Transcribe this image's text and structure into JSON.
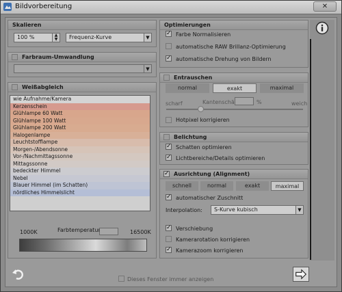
{
  "window": {
    "title": "Bildvorbereitung",
    "close_glyph": "✕"
  },
  "scaling": {
    "header": "Skalieren",
    "percent_value": "100 %",
    "method_value": "Frequenz-Kurve"
  },
  "colorspace": {
    "header": "Farbraum-Umwandlung",
    "checked": false
  },
  "whitebalance": {
    "header": "Weißabgleich",
    "checked": false,
    "items": [
      {
        "label": "wie Aufnahme/Kamera",
        "color": "#d4d4d4"
      },
      {
        "label": "Kerzenschein",
        "color": "#d69a8e"
      },
      {
        "label": "Glühlampe 60 Watt",
        "color": "#d8a68c"
      },
      {
        "label": "Glühlampe 100 Watt",
        "color": "#d8a88e"
      },
      {
        "label": "Glühlampe 200 Watt",
        "color": "#d8ab90"
      },
      {
        "label": "Halogenlampe",
        "color": "#d8b098"
      },
      {
        "label": "Leuchtstofflampe",
        "color": "#d8bcac"
      },
      {
        "label": "Morgen-/Abendsonne",
        "color": "#d6c4b8"
      },
      {
        "label": "Vor-/Nachmittagssonne",
        "color": "#d4c8c0"
      },
      {
        "label": "Mittagssonne",
        "color": "#d2cac6"
      },
      {
        "label": "bedeckter Himmel",
        "color": "#ccccd0"
      },
      {
        "label": "Nebel",
        "color": "#c6c8d2"
      },
      {
        "label": "Blauer Himmel (im Schatten)",
        "color": "#bec4d4"
      },
      {
        "label": "nördliches Himmelslicht",
        "color": "#b4bed6"
      }
    ],
    "temp_min": "1000K",
    "temp_label": "Farbtemperatur",
    "temp_max": "16500K"
  },
  "optimizations": {
    "header": "Optimierungen",
    "options": [
      {
        "label": "Farbe Normalisieren",
        "checked": true,
        "enabled": true
      },
      {
        "label": "automatische RAW Brillanz-Optimierung",
        "checked": false,
        "enabled": false
      },
      {
        "label": "automatische Drehung von Bildern",
        "checked": true,
        "enabled": true
      }
    ]
  },
  "denoise": {
    "header": "Entrauschen",
    "checked": false,
    "modes": [
      "normal",
      "exakt",
      "maximal"
    ],
    "selected_mode": "exakt",
    "left_label": "scharf",
    "center_label": "Kantenschärfe",
    "percent_sign": "%",
    "right_label": "weich",
    "slider_level": 0.25,
    "hotpixel_label": "Hotpixel korrigieren",
    "hotpixel_checked": false
  },
  "exposure": {
    "header": "Belichtung",
    "checked": false,
    "options": [
      {
        "label": "Schatten optimieren",
        "checked": true
      },
      {
        "label": "Lichtbereiche/Details optimieren",
        "checked": true
      }
    ]
  },
  "alignment": {
    "header": "Ausrichtung (Alignment)",
    "checked": true,
    "modes": [
      "schnell",
      "normal",
      "exakt",
      "maximal"
    ],
    "selected_mode": "maximal",
    "autocrop_label": "automatischer Zuschnitt",
    "autocrop_checked": true,
    "interp_label": "Interpolation:",
    "interp_value": "S-Kurve kubisch",
    "options": [
      {
        "label": "Verschiebung",
        "checked": true,
        "enabled": true
      },
      {
        "label": "Kamerarotation korrigieren",
        "checked": false,
        "enabled": false
      },
      {
        "label": "Kamerazoom korrigieren",
        "checked": true,
        "enabled": true
      }
    ]
  },
  "footer": {
    "show_again_label": "Dieses Fenster immer anzeigen",
    "show_again_checked": false,
    "back_glyph": "↶",
    "next_glyph": "⇨"
  },
  "icons": {
    "title": "app-logo-icon",
    "info": "info-icon",
    "back": "back-arrow-icon",
    "next": "next-arrow-icon"
  }
}
